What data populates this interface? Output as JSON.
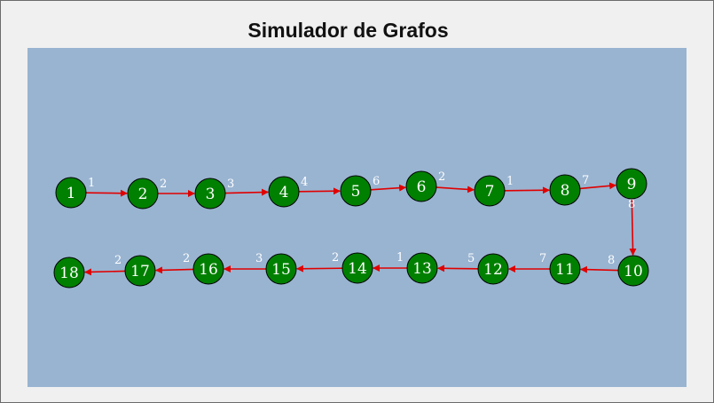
{
  "window": {
    "title": "Simulador de Grafos"
  },
  "colors": {
    "canvas": "#99b4d1",
    "node_fill": "#008000",
    "node_stroke": "#000000",
    "edge": "#e00000",
    "label": "#ffffff"
  },
  "graph": {
    "nodes": [
      "1",
      "2",
      "3",
      "4",
      "5",
      "6",
      "7",
      "8",
      "9",
      "10",
      "11",
      "12",
      "13",
      "14",
      "15",
      "16",
      "17",
      "18"
    ],
    "edges": [
      {
        "from": "1",
        "to": "2",
        "weight": "1"
      },
      {
        "from": "2",
        "to": "3",
        "weight": "2"
      },
      {
        "from": "3",
        "to": "4",
        "weight": "3"
      },
      {
        "from": "4",
        "to": "5",
        "weight": "4"
      },
      {
        "from": "5",
        "to": "6",
        "weight": "6"
      },
      {
        "from": "6",
        "to": "7",
        "weight": "2"
      },
      {
        "from": "7",
        "to": "8",
        "weight": "1"
      },
      {
        "from": "8",
        "to": "9",
        "weight": "7"
      },
      {
        "from": "9",
        "to": "10",
        "weight": "8"
      },
      {
        "from": "10",
        "to": "11",
        "weight": "8"
      },
      {
        "from": "11",
        "to": "12",
        "weight": "7"
      },
      {
        "from": "12",
        "to": "13",
        "weight": "5"
      },
      {
        "from": "13",
        "to": "14",
        "weight": "1"
      },
      {
        "from": "14",
        "to": "15",
        "weight": "2"
      },
      {
        "from": "15",
        "to": "16",
        "weight": "3"
      },
      {
        "from": "16",
        "to": "17",
        "weight": "2"
      },
      {
        "from": "17",
        "to": "18",
        "weight": "2"
      }
    ]
  }
}
